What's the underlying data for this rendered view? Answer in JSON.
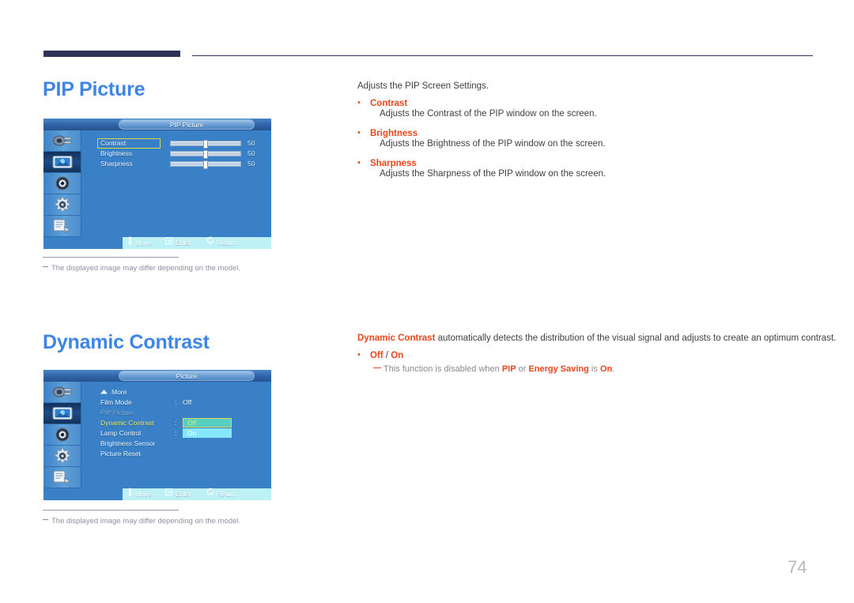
{
  "page": {
    "number": "74"
  },
  "sections": [
    {
      "id": "pip",
      "title": "PIP Picture",
      "lead": "Adjusts the PIP Screen Settings.",
      "bullets": [
        {
          "label": "Contrast",
          "desc": "Adjusts the Contrast of the PIP window on the screen."
        },
        {
          "label": "Brightness",
          "desc": "Adjusts the Brightness of the PIP window on the screen."
        },
        {
          "label": "Sharpness",
          "desc": "Adjusts the Sharpness of the PIP window on the screen."
        }
      ],
      "footnote": "The displayed image may differ depending on the model.",
      "osd": {
        "title": "PIP Picture",
        "rows": [
          {
            "label": "Contrast",
            "value": "50",
            "selected": true
          },
          {
            "label": "Brightness",
            "value": "50",
            "selected": false
          },
          {
            "label": "Sharpness",
            "value": "50",
            "selected": false
          }
        ],
        "footer": [
          {
            "icon": "move-icon",
            "label": "Move"
          },
          {
            "icon": "enter-icon",
            "label": "Enter"
          },
          {
            "icon": "return-icon",
            "label": "Return"
          }
        ],
        "side_icons": [
          "input-source-icon",
          "picture-icon",
          "sound-icon",
          "system-gear-icon",
          "multi-control-icon"
        ],
        "selected_side_icon": "picture-icon"
      }
    },
    {
      "id": "dynamic",
      "title": "Dynamic Contrast",
      "intro_strong": "Dynamic Contrast",
      "intro_rest": " automatically detects the distribution of the visual signal and adjusts to create an optimum contrast.",
      "option_off": "Off",
      "option_sep": " / ",
      "option_on": "On",
      "note": {
        "pre": "This function is disabled when ",
        "term1": "PIP",
        "mid": " or ",
        "term2": "Energy Saving",
        "mid2": " is ",
        "term3": "On",
        "post": "."
      },
      "footnote": "The displayed image may differ depending on the model.",
      "osd": {
        "title": "Picture",
        "more_label": "More",
        "rows": [
          {
            "label": "Film Mode",
            "colon": ":",
            "value": "Off",
            "state": "normal"
          },
          {
            "label": "PIP Picture",
            "colon": "",
            "value": "",
            "state": "dim"
          },
          {
            "label": "Dynamic Contrast",
            "colon": ":",
            "value": "",
            "state": "yellow"
          },
          {
            "label": "Lamp Control",
            "colon": ":",
            "value": "",
            "state": "normal"
          },
          {
            "label": "Brightness Sensor",
            "colon": "",
            "value": "",
            "state": "normal"
          },
          {
            "label": "Picture Reset",
            "colon": "",
            "value": "",
            "state": "normal"
          }
        ],
        "dropdown": {
          "off": "Off",
          "on": "On"
        },
        "footer": [
          {
            "icon": "move-icon",
            "label": "Move"
          },
          {
            "icon": "enter-icon",
            "label": "Enter"
          },
          {
            "icon": "return-icon",
            "label": "Return"
          }
        ],
        "side_icons": [
          "input-source-icon",
          "picture-icon",
          "sound-icon",
          "system-gear-icon",
          "multi-control-icon"
        ],
        "selected_side_icon": "picture-icon"
      }
    }
  ],
  "colors": {
    "heading_blue": "#3d85e8",
    "accent_red": "#e8481b",
    "rule_navy": "#2e3257",
    "osd_blue": "#3a80c6",
    "osd_yellow": "#f2e54f",
    "osd_footer": "#bdf1f6"
  }
}
